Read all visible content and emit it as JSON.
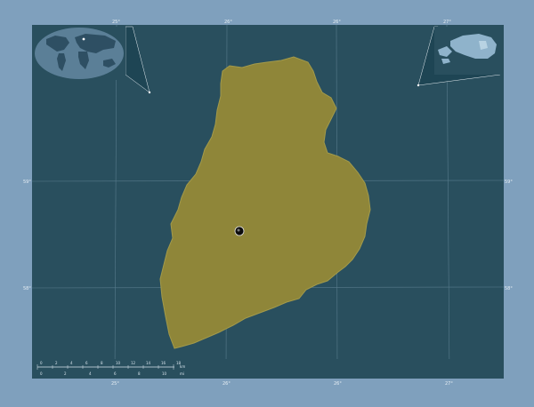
{
  "map": {
    "background_color": "#7fa0bd",
    "frame_color": "#294f5e",
    "region_fill": "#8f8639",
    "region_stroke": "#a39a4a",
    "graticule_color": "#6c8ea0",
    "capital_marker": "black-dot-marker"
  },
  "longitude_labels_top": [
    "25°",
    "26°",
    "26°",
    "27°"
  ],
  "longitude_labels_bottom": [
    "25°",
    "26°",
    "26°",
    "27°"
  ],
  "latitude_labels_left": [
    "59°",
    "58°"
  ],
  "latitude_labels_right": [
    "59°",
    "58°"
  ],
  "scale_bar": {
    "top_values": [
      "0",
      "2",
      "4",
      "6",
      "8",
      "10",
      "12",
      "14",
      "16",
      "18"
    ],
    "top_unit": "km",
    "bottom_values": [
      "0",
      "2",
      "4",
      "6",
      "8",
      "10"
    ],
    "bottom_unit": "mi"
  },
  "insets": [
    {
      "name": "world-locator-inset"
    },
    {
      "name": "country-locator-inset"
    }
  ]
}
